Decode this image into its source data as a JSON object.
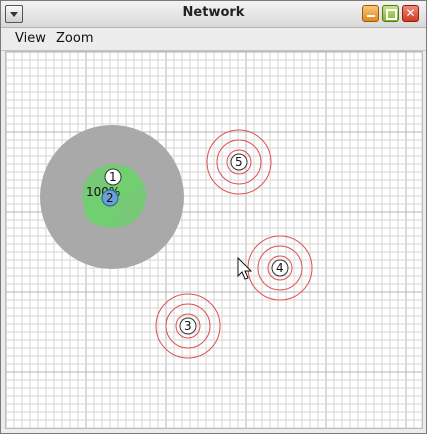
{
  "window": {
    "title": "Network",
    "close_glyph": "✕",
    "menu_icon": "window-menu-icon",
    "controls": [
      "minimize-icon",
      "maximize-icon",
      "close-icon"
    ]
  },
  "menubar": {
    "items": [
      "View",
      "Zoom"
    ]
  },
  "canvas": {
    "grid": true,
    "colors": {
      "grid_fine": "#d6d6d6",
      "grid_major": "#b4b4b4",
      "coverage": "#a9a9a9",
      "signal": "#6fcf6f",
      "selected_node": "#6aa0d6",
      "range_ring": "#e05050"
    },
    "nodes": [
      {
        "id": "1",
        "label": "1"
      },
      {
        "id": "2",
        "label": "2"
      },
      {
        "id": "3",
        "label": "3"
      },
      {
        "id": "4",
        "label": "4"
      },
      {
        "id": "5",
        "label": "5"
      }
    ],
    "overlay_text": "100%",
    "cursor_icon": "mouse-pointer-icon"
  }
}
